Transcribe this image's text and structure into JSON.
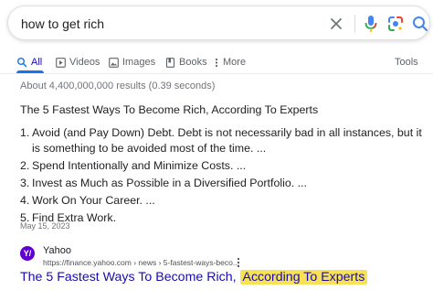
{
  "search": {
    "query": "how to get rich",
    "icons": [
      "close-icon",
      "microphone-icon",
      "google-lens-icon",
      "search-icon"
    ]
  },
  "tabs": [
    {
      "label": "All",
      "icon": "search-icon",
      "active": true
    },
    {
      "label": "Videos",
      "icon": "play-icon"
    },
    {
      "label": "Images",
      "icon": "image-icon"
    },
    {
      "label": "Books",
      "icon": "book-icon"
    },
    {
      "label": "More",
      "icon": "more-vert-icon"
    }
  ],
  "tools_label": "Tools",
  "results_stats": "About 4,400,000,000 results (0.39 seconds)",
  "featured_snippet": {
    "title": "The 5 Fastest Ways To Become Rich, According To Experts",
    "items": [
      {
        "num": "1.",
        "text": "Avoid (and Pay Down) Debt. Debt is not necessarily bad in all instances, but it is something to be avoided most of the time. ..."
      },
      {
        "num": "2.",
        "text": "Spend Intentionally and Minimize Costs. ..."
      },
      {
        "num": "3.",
        "text": "Invest as Much as Possible in a Diversified Portfolio. ..."
      },
      {
        "num": "4.",
        "text": "Work On Your Career. ..."
      },
      {
        "num": "5.",
        "text": "Find Extra Work."
      }
    ],
    "date": "May 15, 2023"
  },
  "source": {
    "favicon_text": "Y/",
    "site_name": "Yahoo",
    "url": "https://finance.yahoo.com › news › 5-fastest-ways-beco...",
    "link_title_main": "The 5 Fastest Ways To Become Rich,",
    "link_title_highlight": "According To Experts"
  },
  "colors": {
    "link": "#1a0dab",
    "active_tab": "#1a73e8",
    "highlight": "#f7e154",
    "yahoo_brand": "#6001d2"
  }
}
